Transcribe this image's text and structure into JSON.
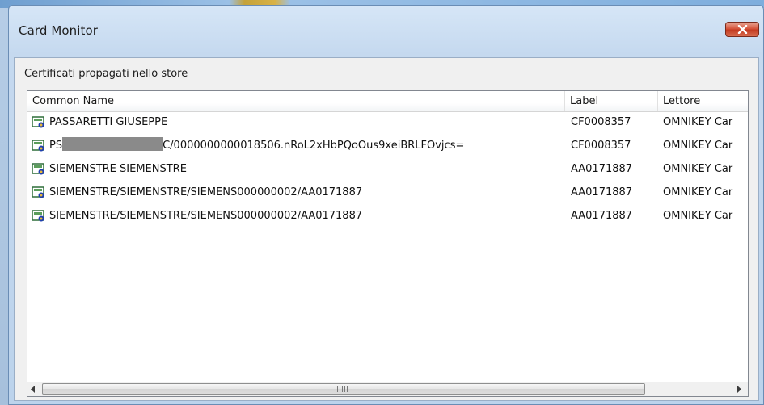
{
  "window": {
    "title": "Card Monitor"
  },
  "section_label": "Certificati propagati nello store",
  "columns": [
    {
      "label": "Common Name"
    },
    {
      "label": "Label"
    },
    {
      "label": "Lettore"
    }
  ],
  "rows": [
    {
      "common_name": "PASSARETTI GIUSEPPE",
      "label": "CF0008357",
      "reader": "OMNIKEY Car"
    },
    {
      "common_name_prefix": "PS",
      "common_name_suffix": "C/0000000000018506.nRoL2xHbPQoOus9xeiBRLFOvjcs=",
      "label": "CF0008357",
      "reader": "OMNIKEY Car"
    },
    {
      "common_name": "SIEMENSTRE SIEMENSTRE",
      "label": "AA0171887",
      "reader": "OMNIKEY Car"
    },
    {
      "common_name": "SIEMENSTRE/SIEMENSTRE/SIEMENS000000002/AA0171887",
      "label": "AA0171887",
      "reader": "OMNIKEY Car"
    },
    {
      "common_name": "SIEMENSTRE/SIEMENSTRE/SIEMENS000000002/AA0171887",
      "label": "AA0171887",
      "reader": "OMNIKEY Car"
    }
  ],
  "icons": {
    "row_icon": "certificate-icon",
    "close": "close-icon",
    "scroll_left": "arrow-left-icon",
    "scroll_right": "arrow-right-icon"
  },
  "colors": {
    "close_button": "#c33b21",
    "title_bar": "#c5d9ef"
  }
}
